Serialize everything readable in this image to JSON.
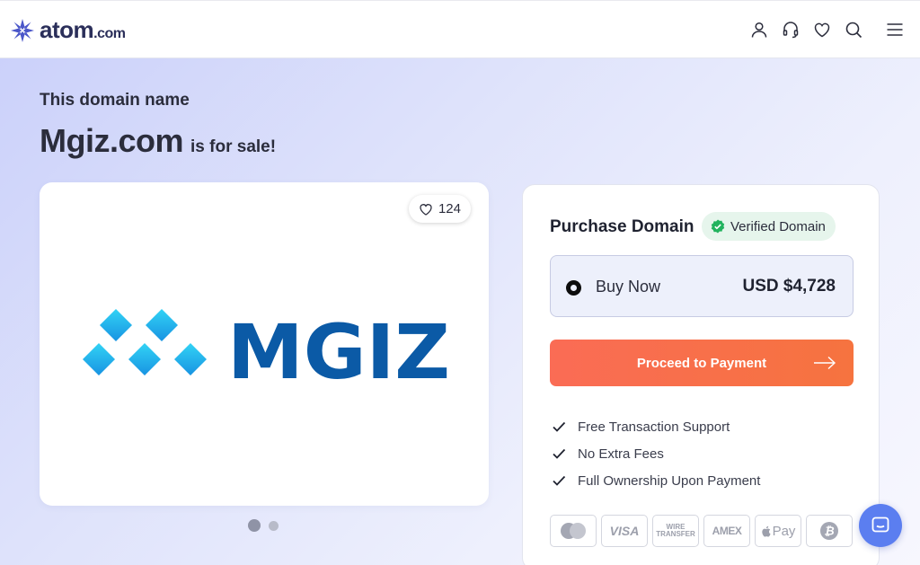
{
  "header": {
    "logo_text": "atom",
    "logo_suffix": ".com",
    "icons": [
      "user-icon",
      "headset-icon",
      "heart-icon",
      "search-icon",
      "menu-icon"
    ]
  },
  "hero": {
    "eyebrow": "This domain name",
    "domain": "Mgiz.com",
    "suffix": "is for sale!"
  },
  "preview": {
    "likes_count": "124",
    "brand_wordmark": "MGIZ",
    "slides_total": 2,
    "slides_active": 1
  },
  "purchase": {
    "title": "Purchase Domain",
    "verified_label": "Verified Domain",
    "option_label": "Buy Now",
    "option_price": "USD $4,728",
    "cta_label": "Proceed to Payment",
    "features": [
      "Free Transaction Support",
      "No Extra Fees",
      "Full Ownership Upon Payment"
    ],
    "payment_methods": [
      "Mastercard",
      "VISA",
      "WIRE TRANSFER",
      "AMEX",
      "Pay",
      "Bitcoin"
    ]
  },
  "colors": {
    "brand_navy": "#2b2f5a",
    "cta_orange": "#f86d4c",
    "verified_green": "#22b35e",
    "logo_blue": "#0b5aa6",
    "logo_cyan": "#1fb6ee",
    "chat_blue": "#5b7ef0"
  }
}
